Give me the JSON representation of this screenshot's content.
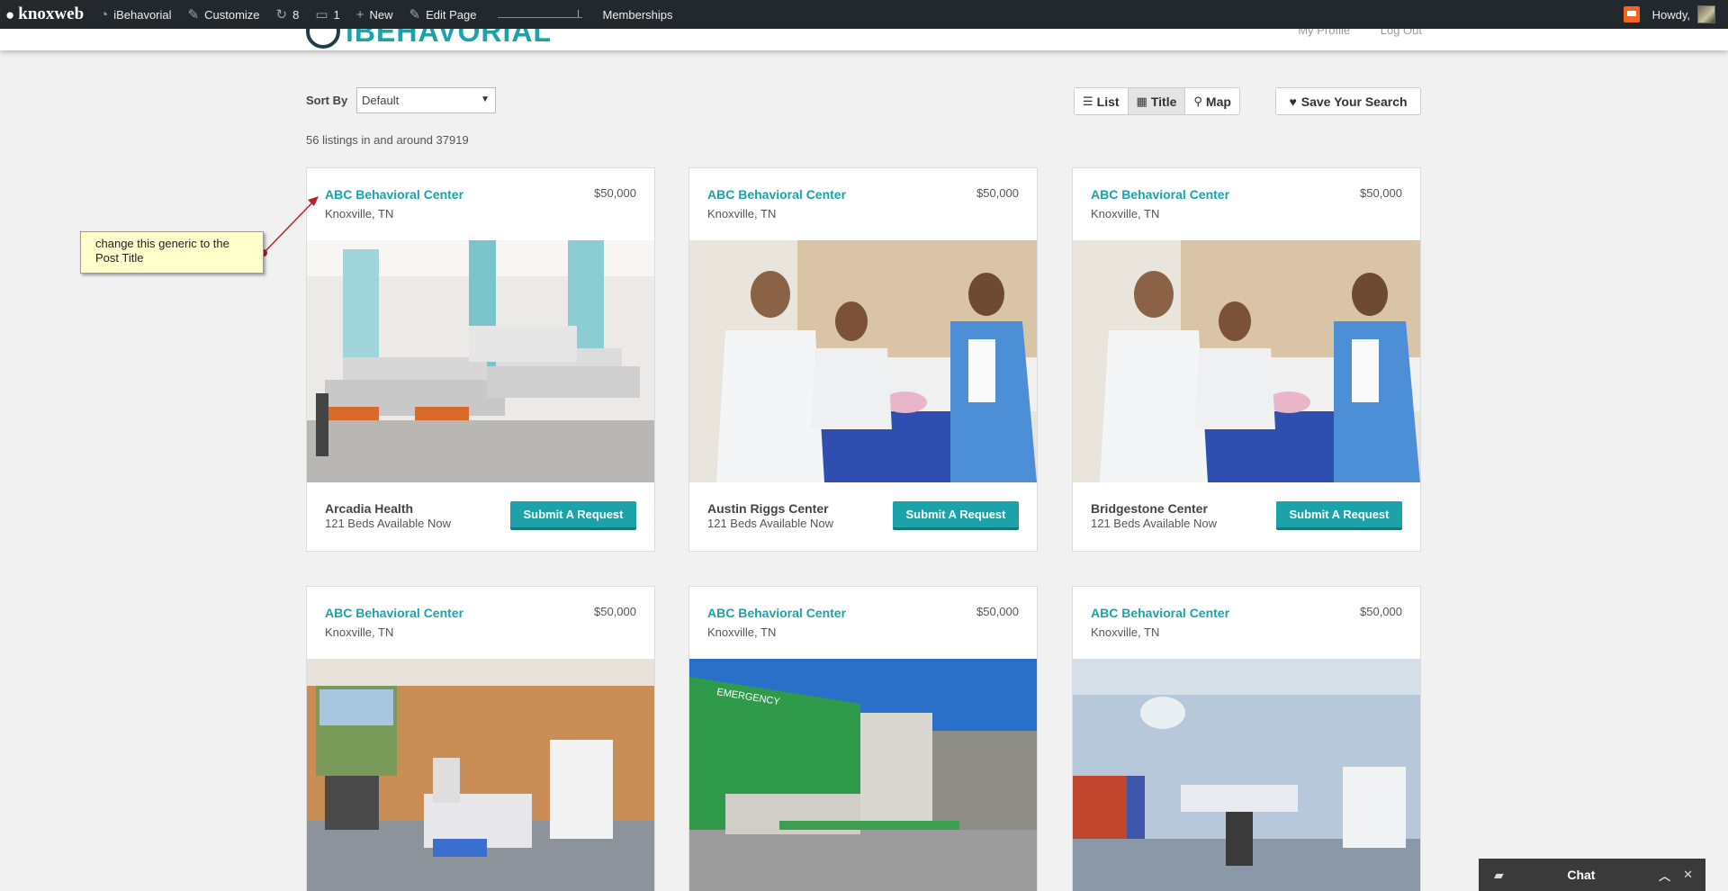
{
  "adminbar": {
    "brand": "knoxweb",
    "site": "iBehavorial",
    "customize": "Customize",
    "updates": "8",
    "comments": "1",
    "new": "New",
    "edit_page": "Edit Page",
    "memberships": "Memberships",
    "howdy": "Howdy,"
  },
  "header": {
    "logo_text": "iBEHAVORIAL",
    "my_profile": "My Profile",
    "log_out": "Log Out"
  },
  "toolbar": {
    "sort_label": "Sort By",
    "sort_value": "Default",
    "count": "56 listings in and around 37919",
    "views": [
      {
        "label": "List",
        "icon": "list-icon",
        "glyph": "☰",
        "active": false
      },
      {
        "label": "Title",
        "icon": "grid-icon",
        "glyph": "▦",
        "active": true
      },
      {
        "label": "Map",
        "icon": "map-marker-icon",
        "glyph": "⚲",
        "active": false
      }
    ],
    "save_search": "Save Your Search"
  },
  "listings": [
    {
      "title": "ABC Behavioral Center",
      "price": "$50,000",
      "location": "Knoxville, TN",
      "name": "Arcadia Health",
      "beds": "121 Beds Available Now",
      "button": "Submit A Request",
      "image": "hospital-ward"
    },
    {
      "title": "ABC Behavioral Center",
      "price": "$50,000",
      "location": "Knoxville, TN",
      "name": "Austin Riggs Center",
      "beds": "121 Beds Available Now",
      "button": "Submit A Request",
      "image": "doctor-nurses-patient"
    },
    {
      "title": "ABC Behavioral Center",
      "price": "$50,000",
      "location": "Knoxville, TN",
      "name": "Bridgestone Center",
      "beds": "121 Beds Available Now",
      "button": "Submit A Request",
      "image": "doctor-nurses-patient"
    },
    {
      "title": "ABC Behavioral Center",
      "price": "$50,000",
      "location": "Knoxville, TN",
      "image": "maternity-room"
    },
    {
      "title": "ABC Behavioral Center",
      "price": "$50,000",
      "location": "Knoxville, TN",
      "image": "emergency-building",
      "sign": "EMERGENCY"
    },
    {
      "title": "ABC Behavioral Center",
      "price": "$50,000",
      "location": "Knoxville, TN",
      "image": "operating-room"
    }
  ],
  "annotation": {
    "text": "change this generic to the Post Title"
  },
  "chat": {
    "label": "Chat"
  },
  "colors": {
    "accent": "#1ba3a9",
    "adminbar": "#23282d",
    "note_bg": "#ffffcc",
    "arrow": "#c0202a"
  }
}
